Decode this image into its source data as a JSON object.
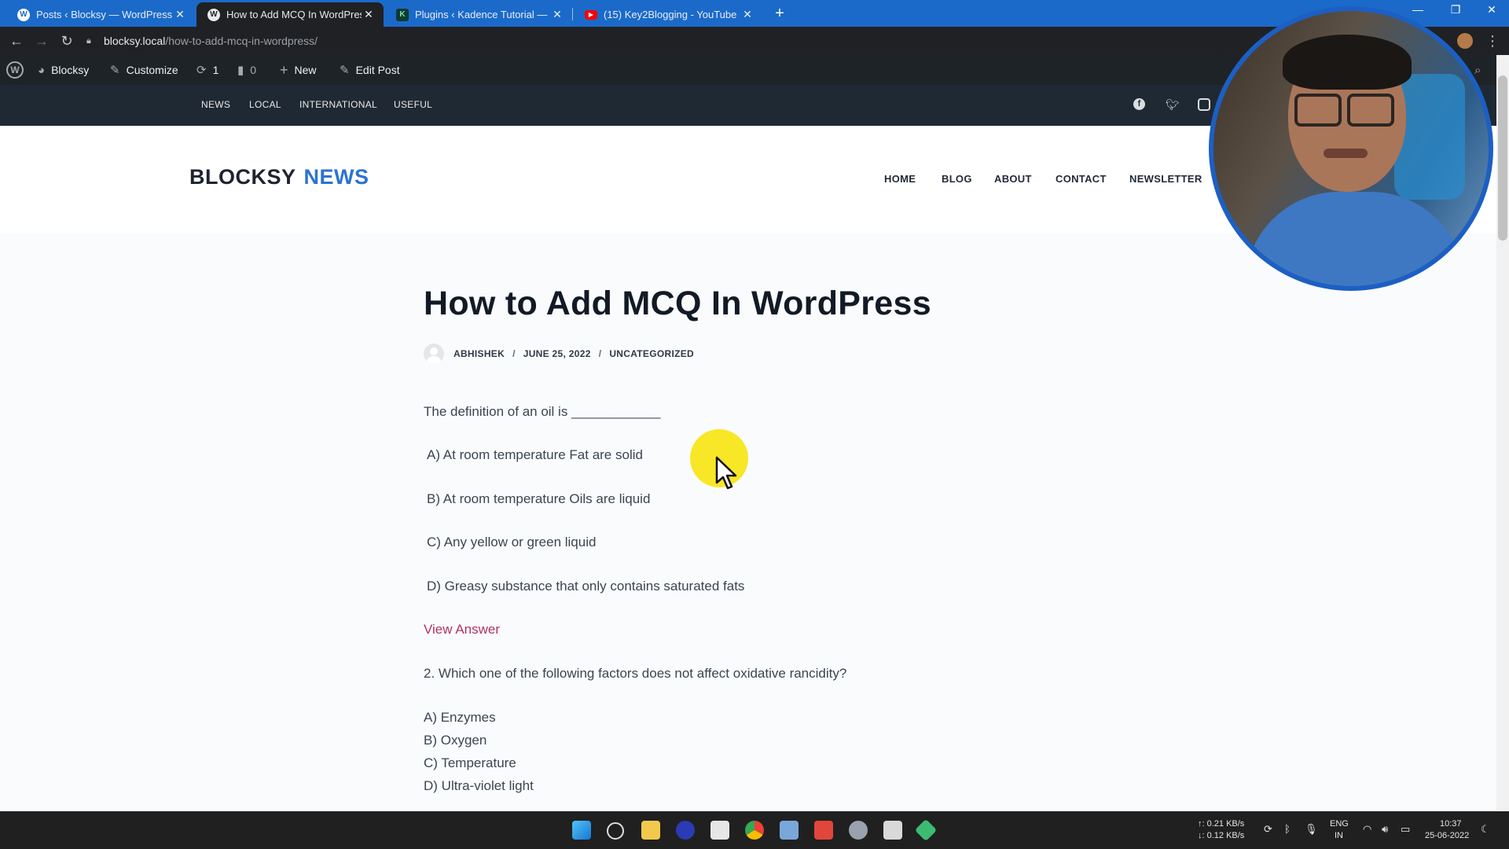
{
  "browser": {
    "tabs": [
      {
        "label": "Posts ‹ Blocksy — WordPress",
        "icon": "wordpress-icon",
        "active": false
      },
      {
        "label": "How to Add MCQ In WordPress",
        "icon": "wordpress-icon",
        "active": true
      },
      {
        "label": "Plugins ‹ Kadence Tutorial — Wo",
        "icon": "kadence-icon",
        "active": false
      },
      {
        "label": "(15) Key2Blogging - YouTube",
        "icon": "youtube-icon",
        "active": false
      }
    ],
    "new_tab": "+",
    "url_host": "blocksy.local",
    "url_path": "/how-to-add-mcq-in-wordpress/"
  },
  "admin_bar": {
    "site": "Blocksy",
    "customize": "Customize",
    "updates": "1",
    "comments": "0",
    "new": "New",
    "edit_post": "Edit Post"
  },
  "top_nav": [
    "NEWS",
    "LOCAL",
    "INTERNATIONAL",
    "USEFUL"
  ],
  "social": [
    "facebook-icon",
    "twitter-icon",
    "instagram-icon"
  ],
  "header": {
    "logo_part1": "BLOCKSY",
    "logo_part2": "NEWS",
    "nav": [
      "HOME",
      "BLOG",
      "ABOUT",
      "CONTACT",
      "NEWSLETTER"
    ]
  },
  "article": {
    "title": "How to Add MCQ In WordPress",
    "author": "ABHISHEK",
    "date": "JUNE 25, 2022",
    "category": "UNCATEGORIZED",
    "q1": "The definition of an oil is ____________",
    "q1_options": [
      "A) At room temperature Fat are solid",
      "B) At room temperature Oils are liquid",
      "C) Any yellow or green liquid",
      "D) Greasy substance that only contains saturated fats"
    ],
    "view_answer": "View Answer",
    "q2": "2. Which one of the following factors does not affect oxidative rancidity?",
    "q2_options": [
      "A) Enzymes",
      "B) Oxygen",
      "C) Temperature",
      "D) Ultra-violet light"
    ]
  },
  "taskbar": {
    "net_up": "↑: 0.21 KB/s",
    "net_down": "↓: 0.12 KB/s",
    "lang1": "ENG",
    "lang2": "IN",
    "time": "10:37",
    "date": "25-06-2022"
  },
  "colors": {
    "accent": "#2c73d2",
    "link": "#b0355f",
    "dark_nav": "#1f2933",
    "admin_bar": "#1d2327"
  }
}
